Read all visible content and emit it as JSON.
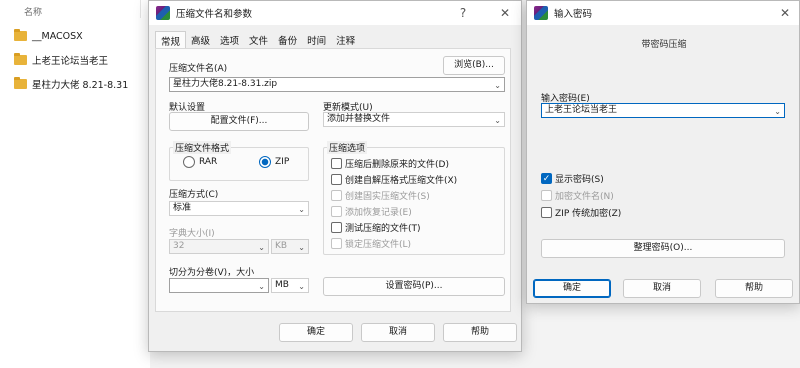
{
  "explorer": {
    "column_name": "名称",
    "items": [
      {
        "name": "__MACOSX"
      },
      {
        "name": "上老王论坛当老王"
      },
      {
        "name": "星柱力大佬 8.21-8.31"
      }
    ]
  },
  "main_dialog": {
    "title": "压缩文件名和参数",
    "help_glyph": "?",
    "close_glyph": "✕",
    "tabs": [
      "常规",
      "高级",
      "选项",
      "文件",
      "备份",
      "时间",
      "注释"
    ],
    "archive_name_label": "压缩文件名(A)",
    "archive_name_value": "星柱力大佬8.21-8.31.zip",
    "browse_button": "浏览(B)...",
    "default_settings_label": "默认设置",
    "profiles_button": "配置文件(F)...",
    "update_mode_label": "更新模式(U)",
    "update_mode_value": "添加并替换文件",
    "format_group_label": "压缩文件格式",
    "format_rar": "RAR",
    "format_zip": "ZIP",
    "selected_format": "ZIP",
    "method_label": "压缩方式(C)",
    "method_value": "标准",
    "dict_size_label": "字典大小(I)",
    "dict_size_value": "32",
    "dict_unit": "KB",
    "split_label": "切分为分卷(V)，大小",
    "split_value": "",
    "split_unit": "MB",
    "options_group_label": "压缩选项",
    "options": [
      {
        "label": "压缩后删除原来的文件(D)",
        "checked": false,
        "enabled": true
      },
      {
        "label": "创建自解压格式压缩文件(X)",
        "checked": false,
        "enabled": true
      },
      {
        "label": "创建固实压缩文件(S)",
        "checked": false,
        "enabled": false
      },
      {
        "label": "添加恢复记录(E)",
        "checked": false,
        "enabled": false
      },
      {
        "label": "测试压缩的文件(T)",
        "checked": false,
        "enabled": true
      },
      {
        "label": "锁定压缩文件(L)",
        "checked": false,
        "enabled": false
      }
    ],
    "set_password_button": "设置密码(P)...",
    "ok_button": "确定",
    "cancel_button": "取消",
    "help_button": "帮助"
  },
  "password_dialog": {
    "title": "输入密码",
    "close_glyph": "✕",
    "subtitle": "带密码压缩",
    "password_label": "输入密码(E)",
    "password_value": "上老王论坛当老王",
    "show_password_label": "显示密码(S)",
    "show_password_checked": true,
    "encrypt_names_label": "加密文件名(N)",
    "encrypt_names_enabled": false,
    "zip_legacy_label": "ZIP 传统加密(Z)",
    "zip_legacy_checked": false,
    "organize_button": "整理密码(O)...",
    "ok_button": "确定",
    "cancel_button": "取消",
    "help_button": "帮助"
  },
  "colors": {
    "accent": "#0067c0",
    "folder": "#e8b33a"
  }
}
